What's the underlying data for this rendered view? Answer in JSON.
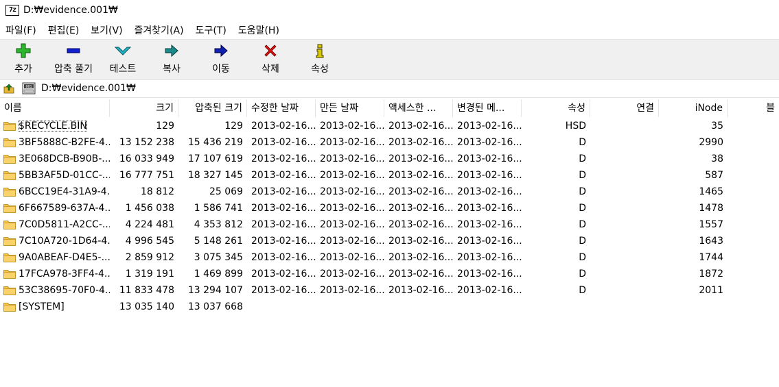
{
  "window": {
    "title": "D:₩evidence.001₩",
    "logo_text": "7z"
  },
  "menu": [
    "파일(F)",
    "편집(E)",
    "보기(V)",
    "즐겨찾기(A)",
    "도구(T)",
    "도움말(H)"
  ],
  "toolbar": {
    "add": "추가",
    "extract": "압축 풀기",
    "test": "테스트",
    "copy": "복사",
    "move": "이동",
    "delete": "삭제",
    "info": "속성"
  },
  "address": {
    "path": "D:₩evidence.001₩"
  },
  "colors": {
    "folder": "#f6c343",
    "add": "#2db52d",
    "extract": "#1020d0",
    "test": "#20b8c8",
    "copy": "#1a8a8a",
    "move": "#1020b0",
    "delete": "#e01010",
    "info": "#d8c800"
  },
  "columns": [
    "이름",
    "크기",
    "압축된 크기",
    "수정한 날짜",
    "만든 날짜",
    "액세스한 ...",
    "변경된 메...",
    "속성",
    "연결",
    "iNode",
    "블"
  ],
  "rows": [
    {
      "name": "$RECYCLE.BIN",
      "size": "129",
      "packed": "129",
      "modified": "2013-02-16...",
      "created": "2013-02-16...",
      "accessed": "2013-02-16...",
      "changed": "2013-02-16...",
      "attr": "HSD",
      "links": "",
      "inode": "35"
    },
    {
      "name": "3BF5888C-B2FE-4...",
      "size": "13 152 238",
      "packed": "15 436 219",
      "modified": "2013-02-16...",
      "created": "2013-02-16...",
      "accessed": "2013-02-16...",
      "changed": "2013-02-16...",
      "attr": "D",
      "links": "",
      "inode": "2990"
    },
    {
      "name": "3E068DCB-B90B-...",
      "size": "16 033 949",
      "packed": "17 107 619",
      "modified": "2013-02-16...",
      "created": "2013-02-16...",
      "accessed": "2013-02-16...",
      "changed": "2013-02-16...",
      "attr": "D",
      "links": "",
      "inode": "38"
    },
    {
      "name": "5BB3AF5D-01CC-...",
      "size": "16 777 751",
      "packed": "18 327 145",
      "modified": "2013-02-16...",
      "created": "2013-02-16...",
      "accessed": "2013-02-16...",
      "changed": "2013-02-16...",
      "attr": "D",
      "links": "",
      "inode": "587"
    },
    {
      "name": "6BCC19E4-31A9-4...",
      "size": "18 812",
      "packed": "25 069",
      "modified": "2013-02-16...",
      "created": "2013-02-16...",
      "accessed": "2013-02-16...",
      "changed": "2013-02-16...",
      "attr": "D",
      "links": "",
      "inode": "1465"
    },
    {
      "name": "6F667589-637A-4...",
      "size": "1 456 038",
      "packed": "1 586 741",
      "modified": "2013-02-16...",
      "created": "2013-02-16...",
      "accessed": "2013-02-16...",
      "changed": "2013-02-16...",
      "attr": "D",
      "links": "",
      "inode": "1478"
    },
    {
      "name": "7C0D5811-A2CC-...",
      "size": "4 224 481",
      "packed": "4 353 812",
      "modified": "2013-02-16...",
      "created": "2013-02-16...",
      "accessed": "2013-02-16...",
      "changed": "2013-02-16...",
      "attr": "D",
      "links": "",
      "inode": "1557"
    },
    {
      "name": "7C10A720-1D64-4...",
      "size": "4 996 545",
      "packed": "5 148 261",
      "modified": "2013-02-16...",
      "created": "2013-02-16...",
      "accessed": "2013-02-16...",
      "changed": "2013-02-16...",
      "attr": "D",
      "links": "",
      "inode": "1643"
    },
    {
      "name": "9A0ABEAF-D4E5-...",
      "size": "2 859 912",
      "packed": "3 075 345",
      "modified": "2013-02-16...",
      "created": "2013-02-16...",
      "accessed": "2013-02-16...",
      "changed": "2013-02-16...",
      "attr": "D",
      "links": "",
      "inode": "1744"
    },
    {
      "name": "17FCA978-3FF4-4...",
      "size": "1 319 191",
      "packed": "1 469 899",
      "modified": "2013-02-16...",
      "created": "2013-02-16...",
      "accessed": "2013-02-16...",
      "changed": "2013-02-16...",
      "attr": "D",
      "links": "",
      "inode": "1872"
    },
    {
      "name": "53C38695-70F0-4...",
      "size": "11 833 478",
      "packed": "13 294 107",
      "modified": "2013-02-16...",
      "created": "2013-02-16...",
      "accessed": "2013-02-16...",
      "changed": "2013-02-16...",
      "attr": "D",
      "links": "",
      "inode": "2011"
    },
    {
      "name": "[SYSTEM]",
      "size": "13 035 140",
      "packed": "13 037 668",
      "modified": "",
      "created": "",
      "accessed": "",
      "changed": "",
      "attr": "",
      "links": "",
      "inode": ""
    }
  ]
}
